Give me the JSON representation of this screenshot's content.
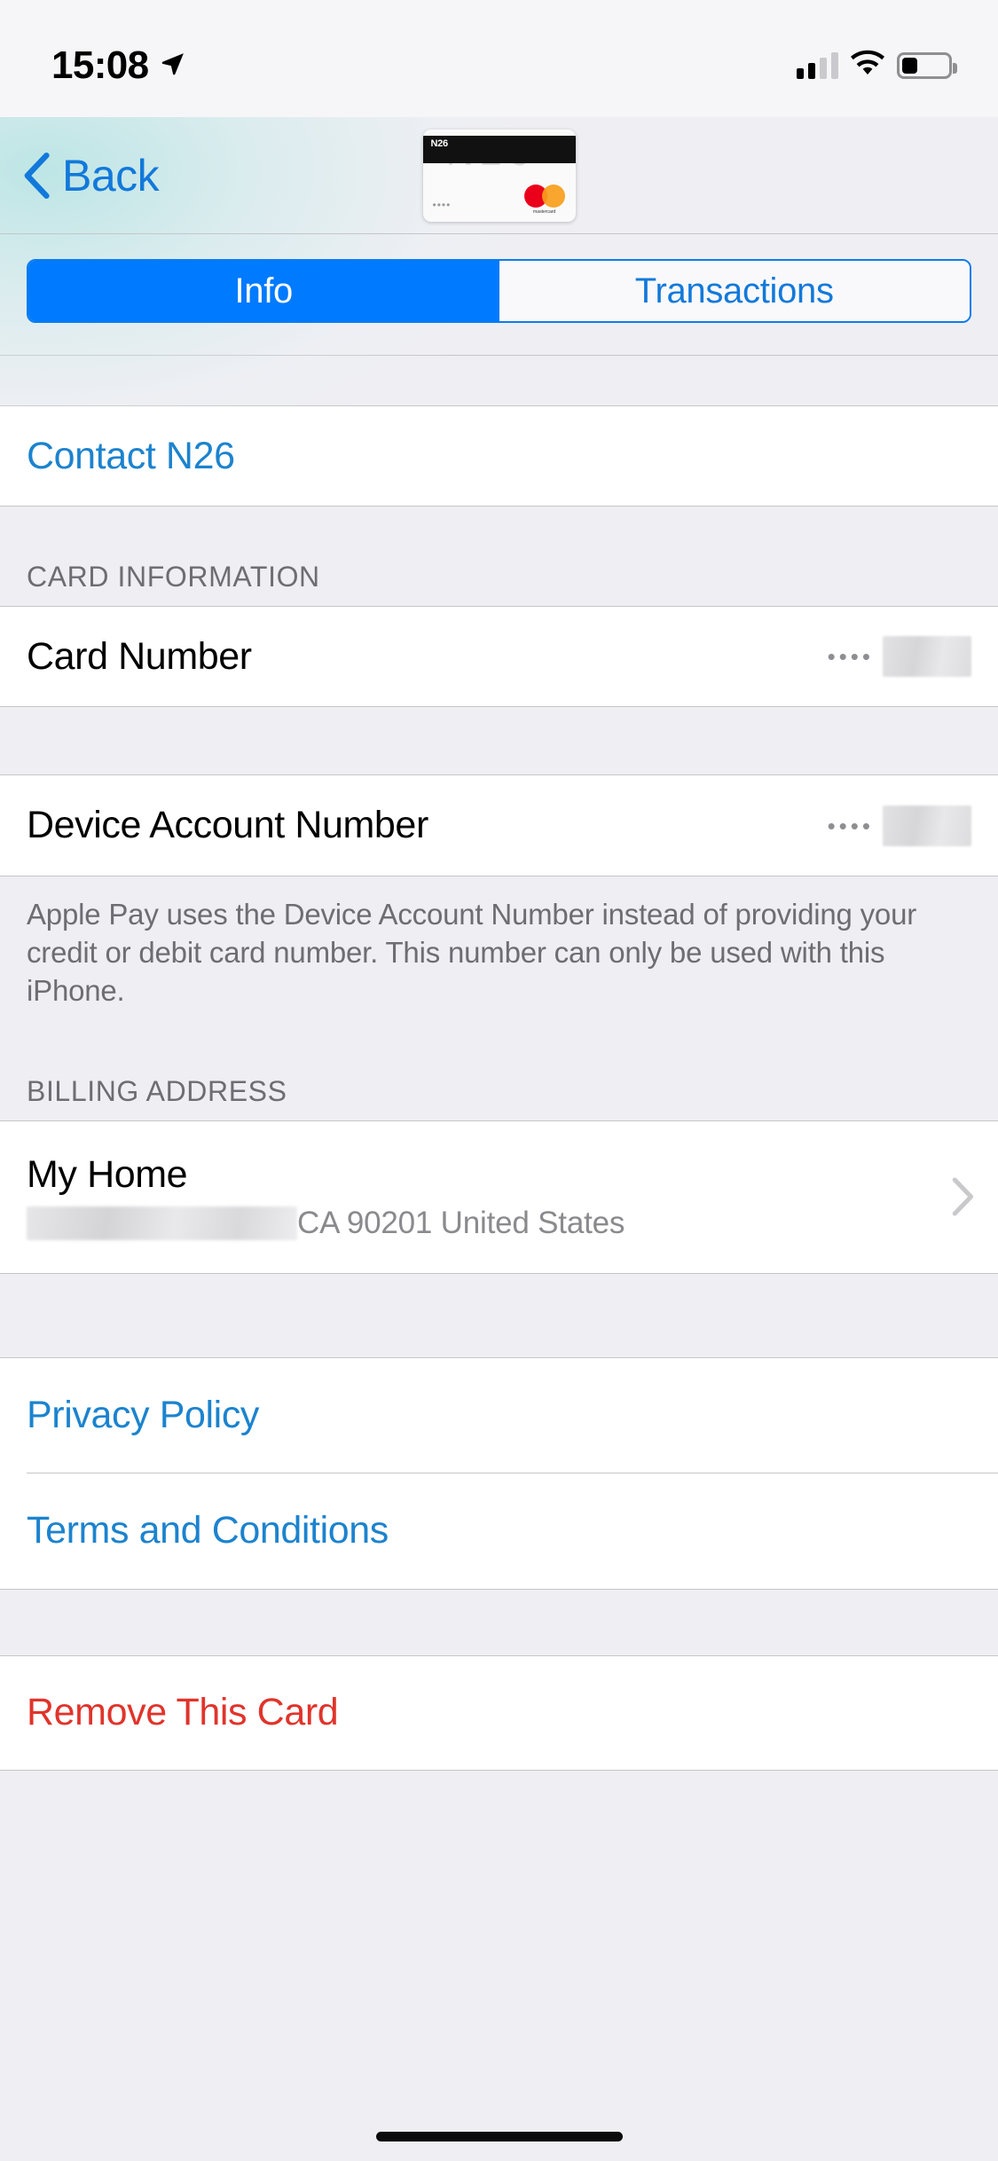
{
  "status_bar": {
    "time": "15:08",
    "location_icon": "location-arrow-icon",
    "cellular_icon": "cellular-signal-icon",
    "cellular_bars_active": 2,
    "cellular_bars_total": 4,
    "wifi_icon": "wifi-icon",
    "battery_icon": "battery-icon",
    "battery_level_percent": 30
  },
  "nav": {
    "back_label": "Back",
    "back_icon": "chevron-left-icon",
    "card_thumbnail": {
      "brand_label": "N26",
      "watermark": "N26",
      "masked_digits": "••••",
      "network": "mastercard",
      "network_label": "mastercard"
    }
  },
  "segmented_control": {
    "options": [
      {
        "label": "Info",
        "selected": true
      },
      {
        "label": "Transactions",
        "selected": false
      }
    ],
    "selected_label": "Info",
    "unselected_label": "Transactions",
    "accent_color": "#007AFF"
  },
  "sections": {
    "contact": {
      "label": "Contact N26",
      "link_color": "#1C83CE"
    },
    "card_information": {
      "header": "CARD INFORMATION",
      "rows": [
        {
          "label": "Card Number",
          "dots": "••••",
          "value": "",
          "redacted": true
        }
      ]
    },
    "device_account": {
      "rows": [
        {
          "label": "Device Account Number",
          "dots": "••••",
          "value": "",
          "redacted": true
        }
      ],
      "footer": "Apple Pay uses the Device Account Number instead of providing your credit or debit card number. This number can only be used with this iPhone."
    },
    "billing_address": {
      "header": "BILLING ADDRESS",
      "name": "My Home",
      "street_redacted": true,
      "address_rest": "CA 90201 United States",
      "disclosure_icon": "chevron-right-icon"
    },
    "legal": {
      "privacy_policy": "Privacy Policy",
      "terms_and_conditions": "Terms and Conditions"
    },
    "remove": {
      "label": "Remove This Card",
      "color": "#E0342B"
    }
  },
  "home_indicator": "home-indicator"
}
